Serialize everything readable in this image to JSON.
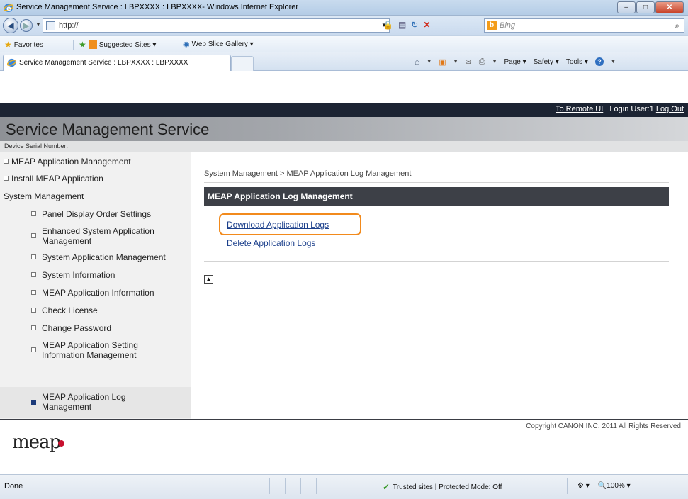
{
  "window": {
    "title": "Service Management Service : LBPXXXX : LBPXXXX- Windows Internet Explorer",
    "minimize": "–",
    "maximize": "□",
    "close": "✕"
  },
  "address": {
    "url": "http://",
    "search_placeholder": "Bing"
  },
  "favorites_bar": {
    "favorites": "Favorites",
    "suggested_sites": "Suggested Sites ▾",
    "web_slice_gallery": "Web Slice Gallery ▾"
  },
  "tab": {
    "label": "Service Management Service : LBPXXXX : LBPXXXX"
  },
  "command_bar": {
    "page": "Page ▾",
    "safety": "Safety ▾",
    "tools": "Tools ▾"
  },
  "top_links": {
    "remote_ui": "To Remote UI",
    "login_user": "Login User:1",
    "logout": "Log Out"
  },
  "header": {
    "title": "Service Management Service",
    "serial_label": "Device Serial Number:"
  },
  "sidebar": {
    "items": [
      {
        "label": "MEAP Application Management"
      },
      {
        "label": "Install MEAP Application"
      },
      {
        "label": "System Management"
      },
      {
        "label": "Panel Display Order Settings"
      },
      {
        "label": "Enhanced System Application Management"
      },
      {
        "label": "System Application Management"
      },
      {
        "label": "System Information"
      },
      {
        "label": "MEAP Application Information"
      },
      {
        "label": "Check License"
      },
      {
        "label": "Change Password"
      },
      {
        "label": "MEAP Application Setting Information Management"
      },
      {
        "label": "MEAP Application Log Management"
      }
    ]
  },
  "main": {
    "breadcrumb": "System Management > MEAP Application Log Management",
    "section_title": "MEAP Application Log Management",
    "download_link": "Download Application Logs",
    "delete_link": "Delete Application Logs",
    "top_button": "▲"
  },
  "footer": {
    "logo": "meap",
    "copyright": "Copyright CANON INC. 2011 All Rights Reserved"
  },
  "status_bar": {
    "status": "Done",
    "zone": "Trusted sites | Protected Mode: Off",
    "zoom": "100%"
  },
  "colors": {
    "highlight": "#f28a1c",
    "section_bar": "#3d4047",
    "link": "#1b3f8b"
  }
}
